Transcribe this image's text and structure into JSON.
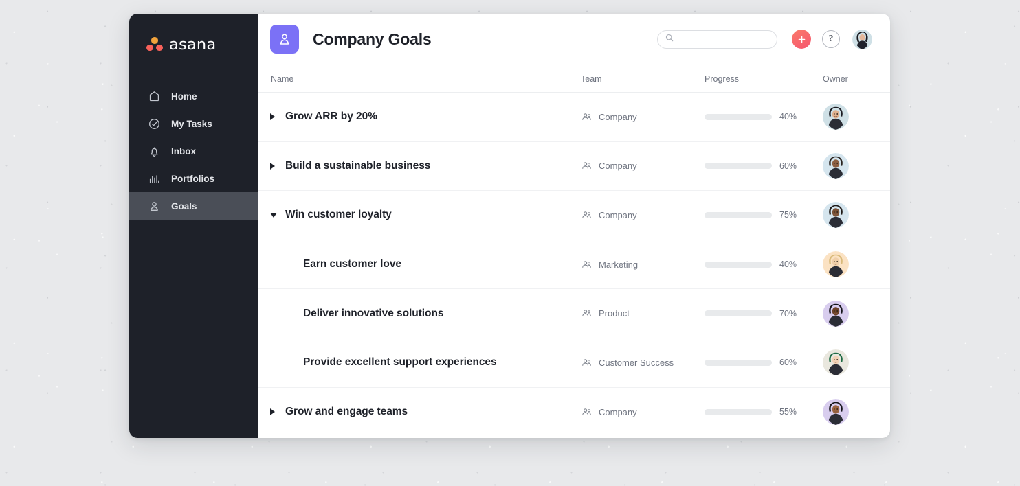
{
  "app": {
    "brand_name": "asana",
    "brand_icon": "asana-logo-icon"
  },
  "sidebar": {
    "items": [
      {
        "label": "Home",
        "icon": "home-icon",
        "active": false
      },
      {
        "label": "My Tasks",
        "icon": "check-circle-icon",
        "active": false
      },
      {
        "label": "Inbox",
        "icon": "bell-icon",
        "active": false
      },
      {
        "label": "Portfolios",
        "icon": "bar-chart-icon",
        "active": false
      },
      {
        "label": "Goals",
        "icon": "goal-person-icon",
        "active": true
      }
    ]
  },
  "topbar": {
    "project_icon": "goal-person-icon",
    "title": "Company Goals",
    "search": {
      "icon": "search-icon",
      "value": "",
      "placeholder": ""
    },
    "add_button": {
      "icon": "plus-icon",
      "label": "+"
    },
    "help_button": {
      "icon": "question-mark-icon",
      "label": "?"
    },
    "user_avatar": {
      "icon": "avatar",
      "bg": "#cfe0e6"
    }
  },
  "table": {
    "columns": [
      "Name",
      "Team",
      "Progress",
      "Owner"
    ],
    "rows": [
      {
        "name": "Grow ARR by 20%",
        "level": 0,
        "expander": "collapsed",
        "team": "Company",
        "progress": 40,
        "progress_label": "40%",
        "progress_color": "#14b785",
        "owner_avatar_bg": "#cfe0e6"
      },
      {
        "name": "Build a sustainable business",
        "level": 0,
        "expander": "collapsed",
        "team": "Company",
        "progress": 60,
        "progress_label": "60%",
        "progress_color": "#f2a30a",
        "owner_avatar_bg": "#d5e5ee"
      },
      {
        "name": "Win customer loyalty",
        "level": 0,
        "expander": "expanded",
        "team": "Company",
        "progress": 75,
        "progress_label": "75%",
        "progress_color": "#14b785",
        "owner_avatar_bg": "#d5e5ee"
      },
      {
        "name": "Earn customer love",
        "level": 1,
        "expander": "none",
        "team": "Marketing",
        "progress": 40,
        "progress_label": "40%",
        "progress_color": "#14b785",
        "owner_avatar_bg": "#fbe2c3"
      },
      {
        "name": "Deliver innovative solutions",
        "level": 1,
        "expander": "none",
        "team": "Product",
        "progress": 70,
        "progress_label": "70%",
        "progress_color": "#f2a30a",
        "owner_avatar_bg": "#d8cdee"
      },
      {
        "name": "Provide excellent support experiences",
        "level": 1,
        "expander": "none",
        "team": "Customer Success",
        "progress": 60,
        "progress_label": "60%",
        "progress_color": "#ef4b5f",
        "owner_avatar_bg": "#e9e7de"
      },
      {
        "name": "Grow and engage teams",
        "level": 0,
        "expander": "collapsed",
        "team": "Company",
        "progress": 55,
        "progress_label": "55%",
        "progress_color": "#14b785",
        "owner_avatar_bg": "#d8cdee"
      }
    ]
  },
  "colors": {
    "sidebar_bg": "#1e2129",
    "sidebar_active_bg": "#4a4e57",
    "accent_purple": "#7b71f6",
    "green": "#14b785",
    "orange": "#f2a30a",
    "red": "#ef4b5f",
    "track": "#e8eaec",
    "backdrop": "#e8e9eb"
  }
}
